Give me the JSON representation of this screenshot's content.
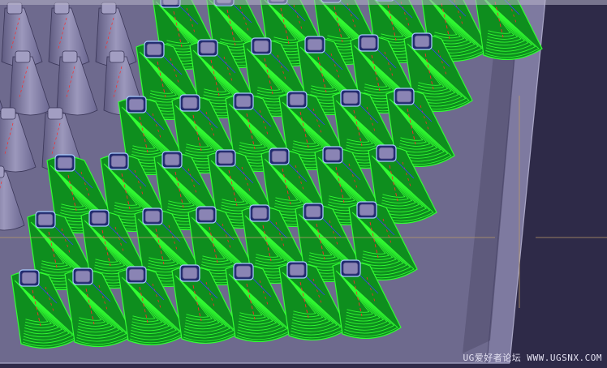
{
  "window": {
    "toolbar_fragments": [
      "",
      "",
      "",
      ""
    ]
  },
  "viewport": {
    "background": "#6e6a8e",
    "bed_color": "#5e5a7c",
    "rim_color": "#7e7aa0",
    "floor_color": "#2e2a48",
    "unprocessed_boss_color": "#8d89ab",
    "toolpath_color": "#33ff33",
    "toolpath_dark": "#0e8e1e",
    "cap_color": "#8a84b4",
    "rapid_move_color": "#ff2a2a",
    "engage_move_color": "#3a3aff",
    "crosshair_color": "#b89a6a",
    "grid": {
      "rows_toolpath": 6,
      "cols_per_row": [
        7,
        7,
        7,
        7,
        7,
        7
      ],
      "rows_unprocessed": 6
    }
  },
  "watermark": {
    "text": "UG爱好者论坛 WWW.UGSNX.COM"
  }
}
